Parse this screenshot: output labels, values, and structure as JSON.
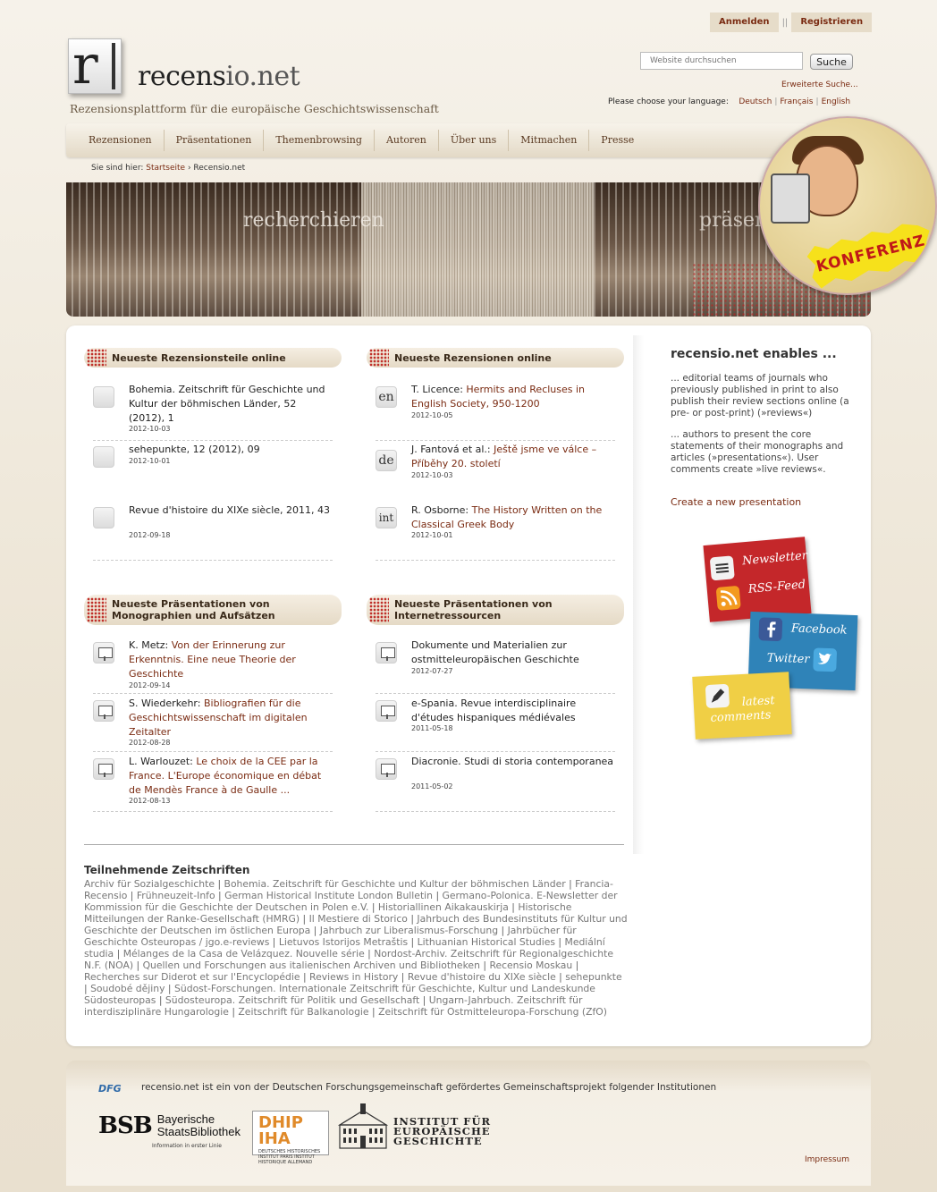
{
  "auth": {
    "login": "Anmelden",
    "separator": "||",
    "register": "Registrieren"
  },
  "logo": {
    "letter": "r",
    "name_main": "recens",
    "name_io": "io",
    "name_tld": ".net",
    "tagline": "Rezensionsplattform für die europäische Geschichtswissenschaft"
  },
  "search": {
    "placeholder": "Website durchsuchen",
    "button": "Suche",
    "advanced": "Erweiterte Suche..."
  },
  "language": {
    "prompt": "Please choose your language:",
    "options": [
      "Deutsch",
      "Français",
      "English"
    ]
  },
  "nav": [
    "Rezensionen",
    "Präsentationen",
    "Themenbrowsing",
    "Autoren",
    "Über uns",
    "Mitmachen",
    "Presse"
  ],
  "breadcrumb": {
    "label": "Sie sind hier:",
    "home": "Startseite",
    "sep": "›",
    "current": "Recensio.net"
  },
  "banner": {
    "word_left": "recherchieren",
    "word_right": "präsen"
  },
  "konferenz": "KONFERENZ",
  "sections": {
    "rezensionsteile": {
      "heading": "Neueste Rezensionsteile online",
      "items": [
        {
          "title": "Bohemia. Zeitschrift für Geschichte und Kultur der böhmischen Länder, 52 (2012), 1",
          "date": "2012-10-03"
        },
        {
          "title": "sehepunkte, 12 (2012), 09",
          "date": "2012-10-01"
        },
        {
          "title": "Revue d'histoire du XIXe siècle, 2011, 43",
          "date": "2012-09-18"
        }
      ]
    },
    "rezensionen": {
      "heading": "Neueste Rezensionen online",
      "items": [
        {
          "lang": "en",
          "author": "T. Licence: ",
          "title": "Hermits and Recluses in English Society, 950-1200",
          "date": "2012-10-05"
        },
        {
          "lang": "de",
          "author": "J. Fantová et al.: ",
          "title": "Ještě jsme ve válce – Příběhy 20. století",
          "date": "2012-10-03"
        },
        {
          "lang": "int",
          "author": "R. Osborne: ",
          "title": "The History Written on the Classical Greek Body",
          "date": "2012-10-01"
        }
      ]
    },
    "praes_mono": {
      "heading_line1": "Neueste Präsentationen von",
      "heading_line2": "Monographien und Aufsätzen",
      "items": [
        {
          "author": "K. Metz: ",
          "title": "Von der Erinnerung zur Erkenntnis. Eine neue Theorie der Geschichte",
          "date": "2012-09-14"
        },
        {
          "author": "S. Wiederkehr: ",
          "title": "Bibliografien für die Geschichtswissenschaft im digitalen Zeitalter",
          "date": "2012-08-28"
        },
        {
          "author": "L. Warlouzet: ",
          "title": "Le choix de la CEE par la France. L'Europe économique en débat de Mendès France à de Gaulle ...",
          "date": "2012-08-13"
        }
      ]
    },
    "praes_internet": {
      "heading_line1": "Neueste Präsentationen von",
      "heading_line2": "Internetressourcen",
      "items": [
        {
          "title": "Dokumente und Materialien zur ostmitteleuropäischen Geschichte",
          "date": "2012-07-27"
        },
        {
          "title": "e-Spania. Revue interdisciplinaire d'études hispaniques médiévales",
          "date": "2011-05-18"
        },
        {
          "title": "Diacronie. Studi di storia contemporanea",
          "date": "2011-05-02"
        }
      ]
    }
  },
  "enables": {
    "heading": "recensio.net enables ...",
    "p1": "... editorial teams of journals who previously published in print to also publish their review sections online (a pre- or post-print) (»reviews«)",
    "p2": "... authors to present the core statements of their monographs and articles (»presentations«). User comments create »live reviews«.",
    "create": "Create a new presentation"
  },
  "social": {
    "newsletter": "Newsletter",
    "rss": "RSS-Feed",
    "facebook": "Facebook",
    "twitter": "Twitter",
    "latest": "latest",
    "comments": "comments"
  },
  "journals": {
    "heading": "Teilnehmende Zeitschriften",
    "list": [
      "Archiv für Sozialgeschichte",
      "Bohemia. Zeitschrift für Geschichte und Kultur der böhmischen Länder",
      "Francia-Recensio",
      "Frühneuzeit-Info",
      "German Historical Institute London Bulletin",
      "Germano-Polonica. E-Newsletter der Kommission für die Geschichte der Deutschen in Polen e.V.",
      "Historiallinen Aikakauskirja",
      "Historische Mitteilungen der Ranke-Gesellschaft (HMRG)",
      "Il Mestiere di Storico",
      "Jahrbuch des Bundesinstituts für Kultur und Geschichte der Deutschen im östlichen Europa",
      "Jahrbuch zur Liberalismus-Forschung",
      "Jahrbücher für Geschichte Osteuropas / jgo.e-reviews",
      "Lietuvos Istorijos Metraštis",
      "Lithuanian Historical Studies",
      "Mediální studia",
      "Mélanges de la Casa de Velázquez. Nouvelle série",
      "Nordost-Archiv. Zeitschrift für Regionalgeschichte N.F. (NOA)",
      "Quellen und Forschungen aus italienischen Archiven und Bibliotheken",
      "Recensio Moskau",
      "Recherches sur Diderot et sur l'Encyclopédie",
      "Reviews in History",
      "Revue d'histoire du XIXe siècle",
      "sehepunkte",
      "Soudobé dějiny",
      "Südost-Forschungen. Internationale Zeitschrift für Geschichte, Kultur und Landeskunde Südosteuropas",
      "Südosteuropa. Zeitschrift für Politik und Gesellschaft",
      "Ungarn-Jahrbuch. Zeitschrift für interdisziplinäre Hungarologie",
      "Zeitschrift für Balkanologie",
      "Zeitschrift für Ostmitteleuropa-Forschung (ZfO)"
    ]
  },
  "footer": {
    "dfg": "DFG",
    "text": "recensio.net ist ein von der Deutschen Forschungsgemeinschaft gefördertes Gemeinschaftsprojekt folgender Institutionen",
    "bsb_mark": "BSB",
    "bsb_line1": "Bayerische",
    "bsb_line2": "StaatsBibliothek",
    "bsb_sub": "Information in erster Linie",
    "dhip": "DHIP",
    "iha": "IHA",
    "dhip_sub": "DEUTSCHES HISTORISCHES INSTITUT PARIS INSTITUT HISTORIQUE ALLEMAND",
    "ieg_line1": "INSTITUT FÜR",
    "ieg_line2": "EUROPÄISCHE",
    "ieg_line3": "GESCHICHTE",
    "impressum": "Impressum"
  }
}
